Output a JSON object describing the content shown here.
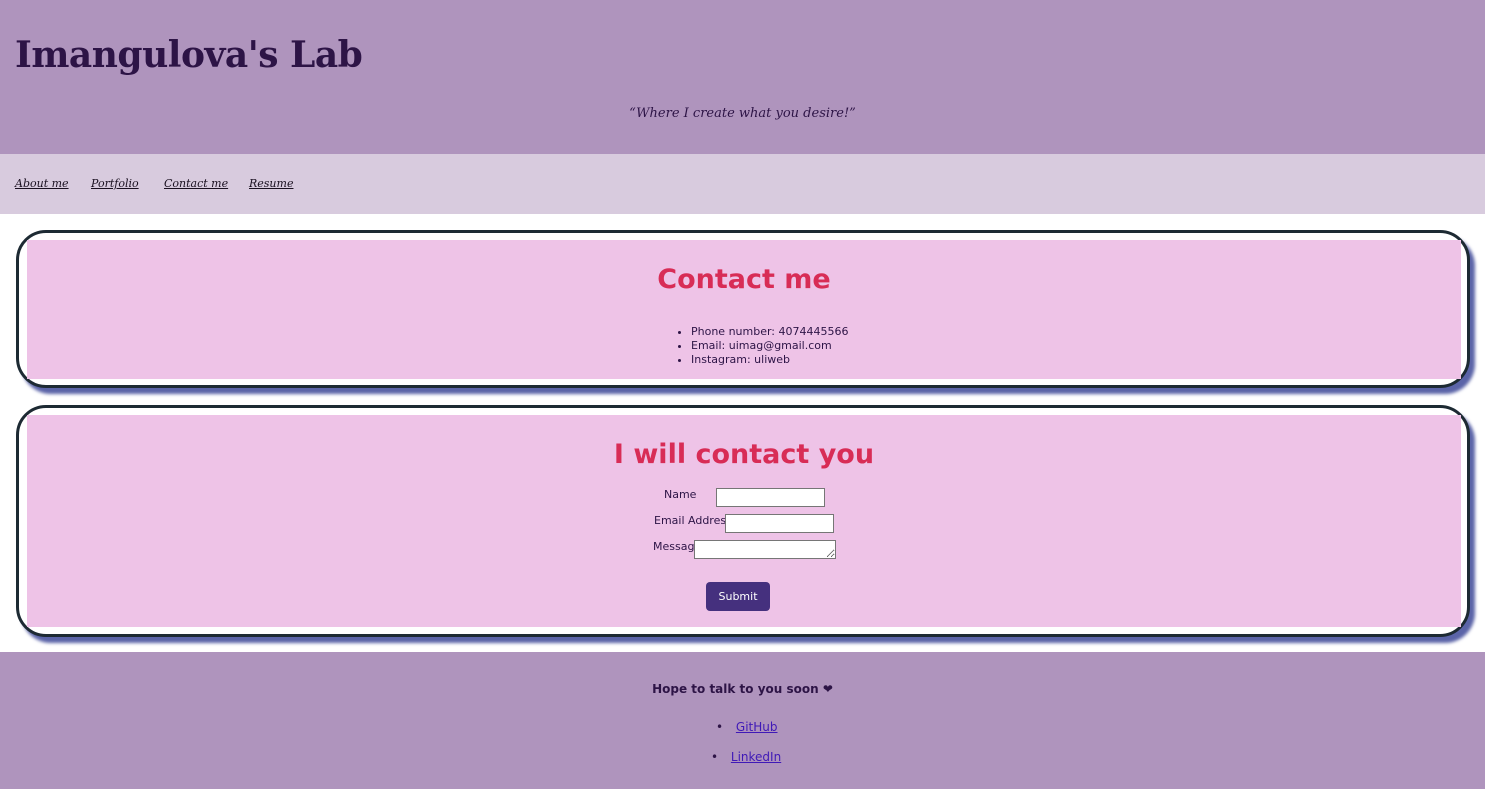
{
  "header": {
    "title": "Imangulova's Lab",
    "tagline": "“Where I create what you desire!”"
  },
  "nav": {
    "items": [
      {
        "label": "About me"
      },
      {
        "label": "Portfolio"
      },
      {
        "label": "Contact me"
      },
      {
        "label": "Resume"
      }
    ]
  },
  "contact_card": {
    "title": "Contact me",
    "items": [
      "Phone number: 4074445566",
      "Email: uimag@gmail.com",
      "Instagram: uliweb"
    ]
  },
  "form_card": {
    "title": "I will contact you",
    "name_label": "Name",
    "name_value": "",
    "email_label": "Email Address",
    "email_value": "",
    "message_label": "Message",
    "message_value": "",
    "submit_label": "Submit"
  },
  "footer": {
    "text": "Hope to talk to you soon ❤",
    "links": [
      {
        "label": "GitHub"
      },
      {
        "label": "LinkedIn"
      }
    ]
  },
  "colors": {
    "header_bg": "#af94bd",
    "nav_bg": "#d8cbde",
    "card_bg": "#eec3e7",
    "heading": "#d82c56",
    "button": "#45307e",
    "link": "#3f19b7"
  }
}
